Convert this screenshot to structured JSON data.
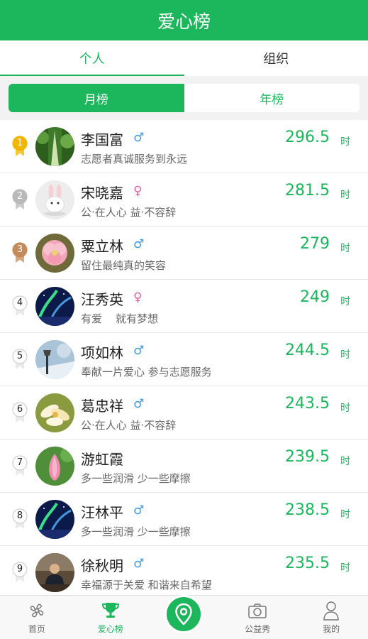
{
  "header": {
    "title": "爱心榜"
  },
  "tabs": [
    {
      "label": "个人",
      "active": true
    },
    {
      "label": "组织",
      "active": false
    }
  ],
  "segment": [
    {
      "label": "月榜",
      "active": true
    },
    {
      "label": "年榜",
      "active": false
    }
  ],
  "colors": {
    "accent": "#1cb65c",
    "male": "#3a9be0",
    "female": "#e05fa0",
    "gold": "#f2b600",
    "silver": "#b9b9b9",
    "bronze": "#c58a5a"
  },
  "ranking": [
    {
      "rank": "1",
      "name": "李国富",
      "gender": "male",
      "gender_icon": "♂",
      "motto": "志愿者真诚服务到永远",
      "hours": "296.5",
      "unit": "时",
      "avatar_icon": "forest-path-avatar"
    },
    {
      "rank": "2",
      "name": "宋晓嘉",
      "gender": "female",
      "gender_icon": "♀",
      "motto": "公·在人心 益·不容辞",
      "hours": "281.5",
      "unit": "时",
      "avatar_icon": "bunny-avatar"
    },
    {
      "rank": "3",
      "name": "粟立林",
      "gender": "male",
      "gender_icon": "♂",
      "motto": "留住最纯真的笑容",
      "hours": "279",
      "unit": "时",
      "avatar_icon": "pink-flower-avatar"
    },
    {
      "rank": "4",
      "name": "汪秀英",
      "gender": "female",
      "gender_icon": "♀",
      "motto": "有爱    就有梦想",
      "hours": "249",
      "unit": "时",
      "avatar_icon": "aurora-avatar"
    },
    {
      "rank": "5",
      "name": "项如林",
      "gender": "male",
      "gender_icon": "♂",
      "motto": "奉献一片爱心 参与志愿服务",
      "hours": "244.5",
      "unit": "时",
      "avatar_icon": "snow-lamp-avatar"
    },
    {
      "rank": "6",
      "name": "葛忠祥",
      "gender": "male",
      "gender_icon": "♂",
      "motto": "公·在人心 益·不容辞",
      "hours": "243.5",
      "unit": "时",
      "avatar_icon": "white-flower-avatar"
    },
    {
      "rank": "7",
      "name": "游虹霞",
      "gender": "none",
      "gender_icon": "",
      "motto": "多一些润滑 少一些摩擦",
      "hours": "239.5",
      "unit": "时",
      "avatar_icon": "lotus-avatar"
    },
    {
      "rank": "8",
      "name": "汪林平",
      "gender": "male",
      "gender_icon": "♂",
      "motto": "多一些润滑 少一些摩擦",
      "hours": "238.5",
      "unit": "时",
      "avatar_icon": "aurora-avatar"
    },
    {
      "rank": "9",
      "name": "徐秋明",
      "gender": "male",
      "gender_icon": "♂",
      "motto": "幸福源于关爱 和谐来自希望",
      "hours": "235.5",
      "unit": "时",
      "avatar_icon": "person-desk-avatar"
    }
  ],
  "tabbar": [
    {
      "label": "首页",
      "icon": "pinwheel-icon",
      "active": false
    },
    {
      "label": "爱心榜",
      "icon": "trophy-icon",
      "active": true
    },
    {
      "label": "",
      "icon": "location-pin-icon",
      "active": false
    },
    {
      "label": "公益秀",
      "icon": "camera-icon",
      "active": false
    },
    {
      "label": "我的",
      "icon": "person-icon",
      "active": false
    }
  ]
}
